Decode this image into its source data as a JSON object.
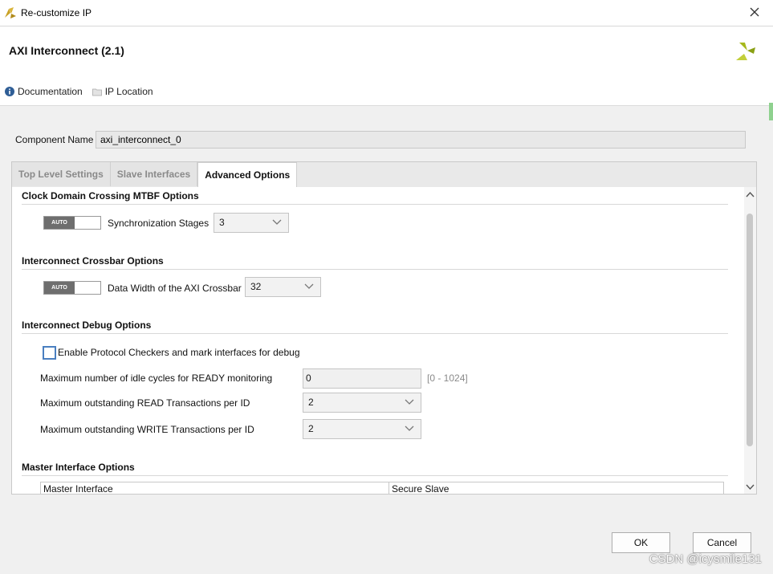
{
  "window": {
    "title": "Re-customize IP"
  },
  "header": {
    "ip_title": "AXI Interconnect (2.1)",
    "links": [
      {
        "icon": "info-icon",
        "label": "Documentation"
      },
      {
        "icon": "folder-icon",
        "label": "IP Location"
      }
    ]
  },
  "component": {
    "label": "Component Name",
    "value": "axi_interconnect_0"
  },
  "tabs": [
    {
      "label": "Top Level Settings",
      "active": false
    },
    {
      "label": "Slave Interfaces",
      "active": false
    },
    {
      "label": "Advanced Options",
      "active": true
    }
  ],
  "clock_domain": {
    "title": "Clock Domain Crossing MTBF Options",
    "toggle_label": "AUTO",
    "field_label": "Synchronization Stages",
    "value": "3"
  },
  "crossbar": {
    "title": "Interconnect Crossbar Options",
    "toggle_label": "AUTO",
    "field_label": "Data Width of the AXI Crossbar",
    "value": "32"
  },
  "debug": {
    "title": "Interconnect Debug Options",
    "checkbox_label": "Enable Protocol Checkers and mark interfaces for debug",
    "checked": false,
    "idle_label": "Maximum number of idle cycles for READY monitoring",
    "idle_value": "0",
    "idle_range": "[0 - 1024]",
    "read_label": "Maximum outstanding READ Transactions per ID",
    "read_value": "2",
    "write_label": "Maximum outstanding WRITE Transactions per ID",
    "write_value": "2"
  },
  "master": {
    "title": "Master Interface Options",
    "columns": [
      "Master Interface",
      "Secure Slave"
    ]
  },
  "buttons": {
    "ok": "OK",
    "cancel": "Cancel"
  },
  "watermark": "CSDN @icysmile131",
  "colors": {
    "accent_blue": "#4a7fc0",
    "logo_yellow": "#a6b81c",
    "toggle_knob": "#6e6e6e"
  }
}
